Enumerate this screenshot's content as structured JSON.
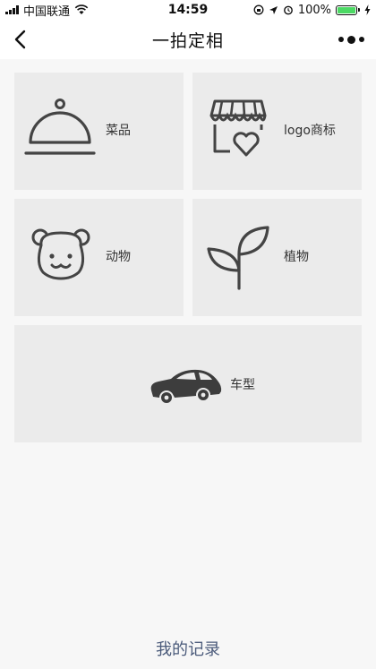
{
  "status_bar": {
    "carrier": "中国联通",
    "time": "14:59",
    "battery": "100%"
  },
  "nav": {
    "title": "一拍定相"
  },
  "categories": [
    {
      "label": "菜品",
      "icon": "food-cloche-icon"
    },
    {
      "label": "logo商标",
      "icon": "store-heart-icon"
    },
    {
      "label": "动物",
      "icon": "bear-face-icon"
    },
    {
      "label": "植物",
      "icon": "sprout-icon"
    },
    {
      "label": "车型",
      "icon": "car-icon"
    }
  ],
  "footer": {
    "history_label": "我的记录"
  },
  "colors": {
    "tile_bg": "#ebebeb",
    "page_bg": "#f7f7f7",
    "icon_stroke": "#444444",
    "footer_link": "#4a5a7a",
    "battery_fill": "#4cd964"
  }
}
